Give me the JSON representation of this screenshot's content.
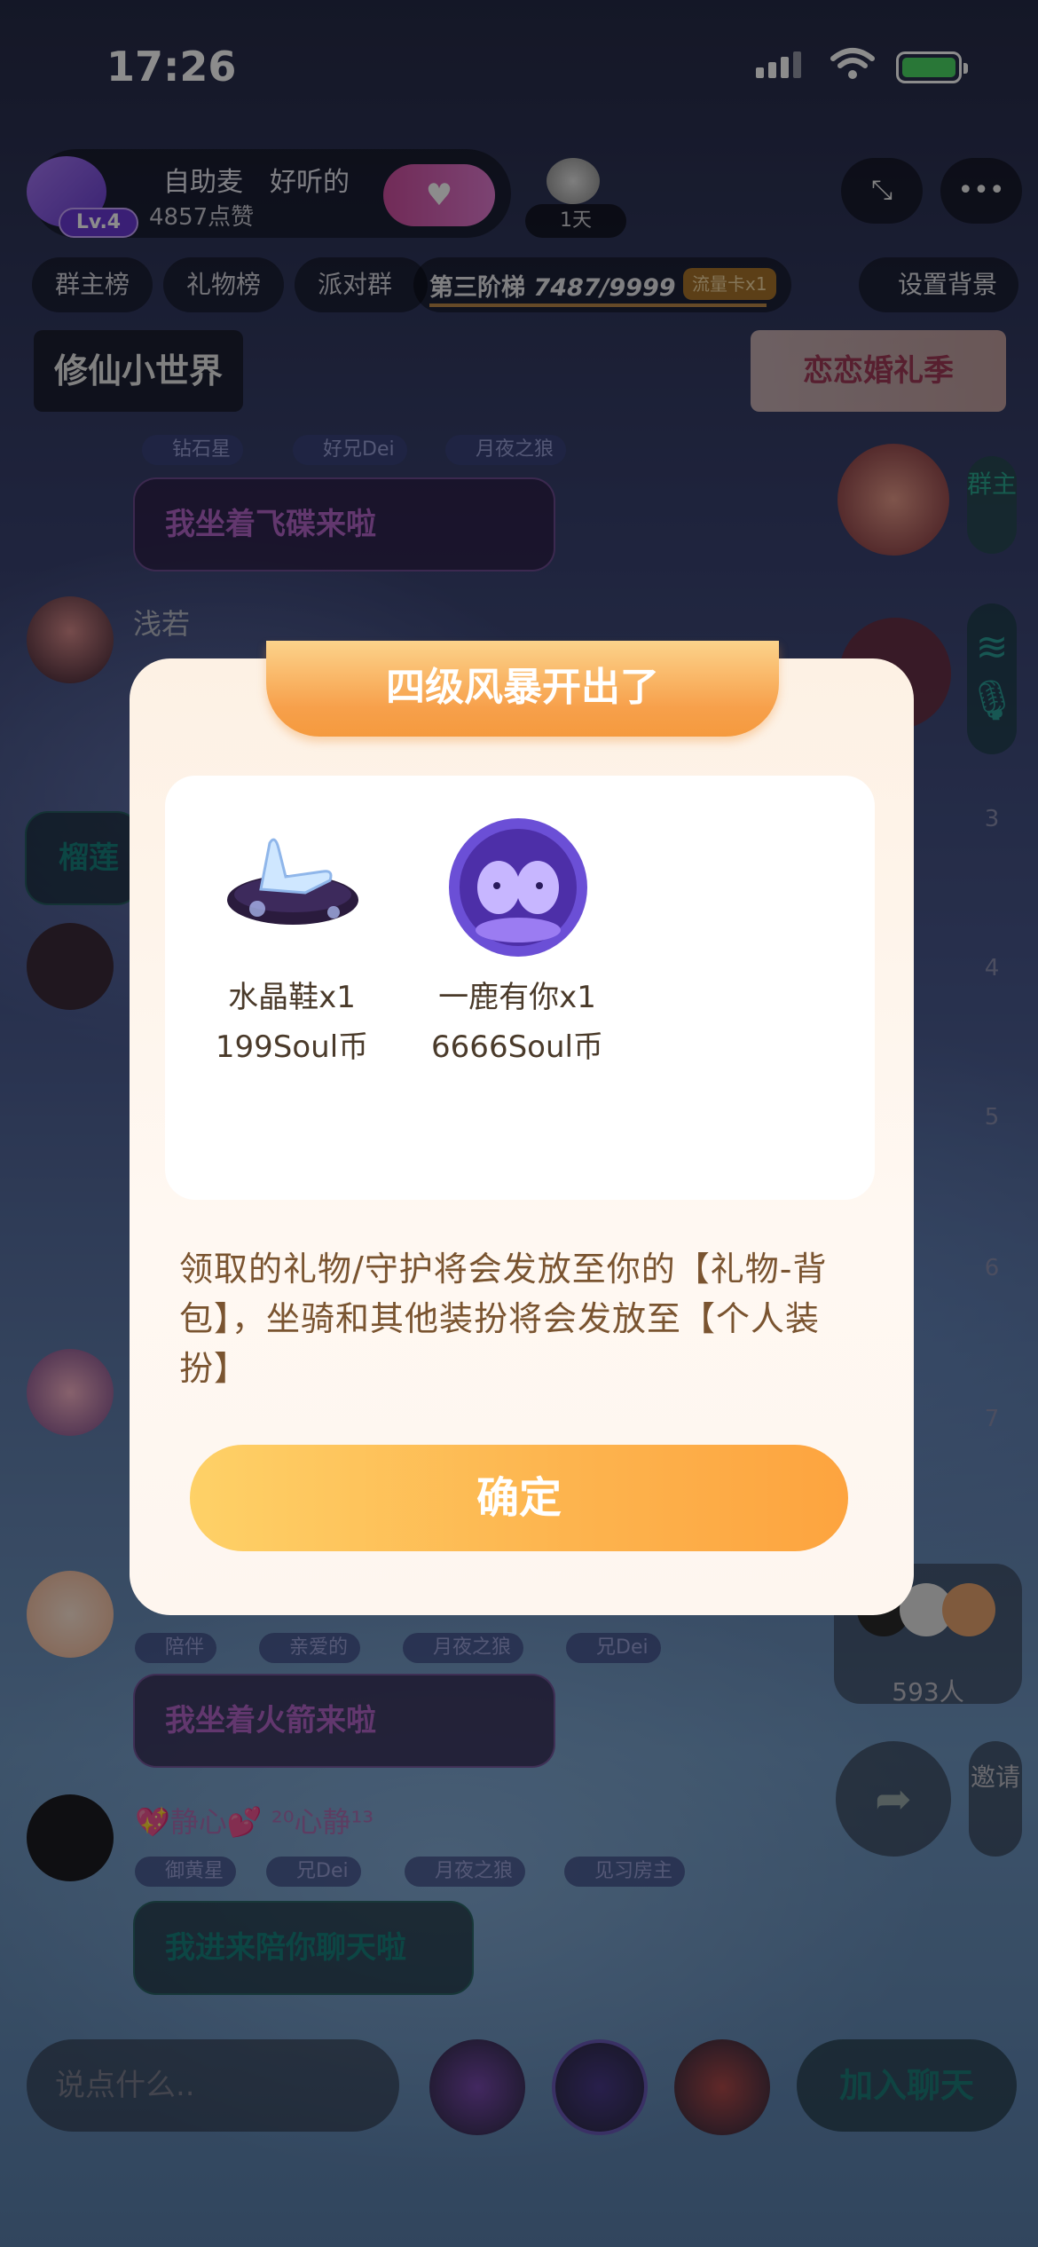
{
  "status_bar": {
    "time": "17:26"
  },
  "room": {
    "level": "Lv.4",
    "title": "自助麦　好听的",
    "likes": "4857点赞",
    "day_label": "1天"
  },
  "tabs": [
    "群主榜",
    "礼物榜",
    "派对群"
  ],
  "ladder": {
    "label": "第三阶梯",
    "progress_text": "7487/9999",
    "progress": 0.749,
    "flow_card": "流量卡x1"
  },
  "set_background": "设置背景",
  "banners": {
    "left": "修仙小世界",
    "right": "恋恋婚礼季"
  },
  "chat": {
    "msg1_badges": [
      "钻石星",
      "好兄Dei",
      "月夜之狼"
    ],
    "msg1_bubble": "我坐着飞碟来啦",
    "user2_name": "浅若",
    "partial_left": "榴莲",
    "msg3_badges": [
      "陪伴",
      "亲爱的",
      "月夜之狼",
      "兄Dei"
    ],
    "msg3_bubble": "我坐着火箭来啦",
    "user4_name": "💖静心💕 ²⁰心静¹³",
    "msg4_badges": [
      "御黄星",
      "兄Dei",
      "月夜之狼",
      "见习房主"
    ],
    "msg4_bubble": "我进来陪你聊天啦"
  },
  "right_column": {
    "owner_label": "群主",
    "ranks": [
      "3",
      "4",
      "5",
      "6",
      "7"
    ],
    "online_count": "593人",
    "invite_label": "邀请"
  },
  "bottom_bar": {
    "input_placeholder": "说点什么..",
    "join_label": "加入聊天"
  },
  "modal": {
    "title": "四级风暴开出了",
    "gifts": [
      {
        "name": "水晶鞋x1",
        "price": "199Soul币",
        "icon": "crystal-shoe-icon"
      },
      {
        "name": "一鹿有你x1",
        "price": "6666Soul币",
        "icon": "deer-pair-icon"
      }
    ],
    "note": "领取的礼物/守护将会发放至你的【礼物-背包】，坐骑和其他装扮将会发放至【个人装扮】",
    "confirm_label": "确定"
  },
  "colors": {
    "accent_orange": "#f7a04b",
    "button_gradient_start": "#fed167",
    "button_gradient_end": "#fda43f",
    "modal_bg": "#fdf1e4"
  }
}
